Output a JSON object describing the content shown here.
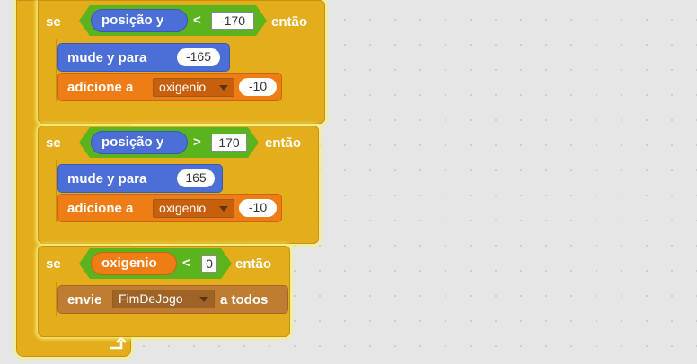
{
  "blocks": {
    "if1": {
      "keyword": "se",
      "then": "então",
      "reporter": "posição  y",
      "operator": "<",
      "value": "-170",
      "stack": [
        {
          "label": "mude  y  para",
          "value": "-165"
        },
        {
          "label": "adicione   a",
          "dropdown": "oxigenio",
          "value": "-10"
        }
      ]
    },
    "if2": {
      "keyword": "se",
      "then": "então",
      "reporter": "posição  y",
      "operator": ">",
      "value": "170",
      "stack": [
        {
          "label": "mude  y  para",
          "value": "165"
        },
        {
          "label": "adicione   a",
          "dropdown": "oxigenio",
          "value": "-10"
        }
      ]
    },
    "if3": {
      "keyword": "se",
      "then": "então",
      "reporter": "oxigenio",
      "operator": "<",
      "value": "0",
      "stack": [
        {
          "label": "envie",
          "dropdown": "FimDeJogo",
          "suffix": "a  todos"
        }
      ]
    },
    "loop_arrow": "↲"
  },
  "colors": {
    "control": "#e3ad1b",
    "motion": "#4b6fd6",
    "data": "#ee7d16",
    "operators": "#5bb31d",
    "events": "#bf7d32",
    "glow": "#f7f27a"
  }
}
